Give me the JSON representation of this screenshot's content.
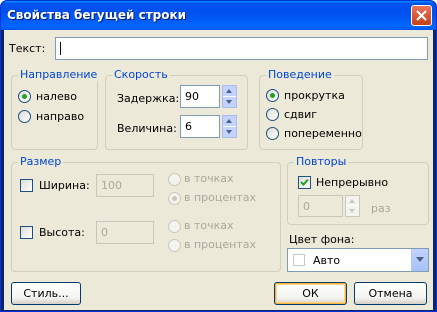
{
  "title": "Свойства бегущей строки",
  "text_field": {
    "label": "Текст:",
    "value": ""
  },
  "direction": {
    "title": "Направление",
    "options": [
      "налево",
      "направо"
    ],
    "selected": 0
  },
  "speed": {
    "title": "Скорость",
    "delay_label": "Задержка:",
    "delay_value": "90",
    "amount_label": "Величина:",
    "amount_value": "6"
  },
  "behavior": {
    "title": "Поведение",
    "options": [
      "прокрутка",
      "сдвиг",
      "попеременно"
    ],
    "selected": 0
  },
  "size": {
    "title": "Размер",
    "width_label": "Ширина:",
    "width_value": "100",
    "height_label": "Высота:",
    "height_value": "0",
    "units": [
      "в точках",
      "в процентах"
    ]
  },
  "repeat": {
    "title": "Повторы",
    "continuous_label": "Непрерывно",
    "count_value": "0",
    "count_unit": "раз"
  },
  "bgcolor": {
    "label": "Цвет фона:",
    "value": "Авто"
  },
  "buttons": {
    "style": "Стиль...",
    "ok": "ОК",
    "cancel": "Отмена"
  }
}
